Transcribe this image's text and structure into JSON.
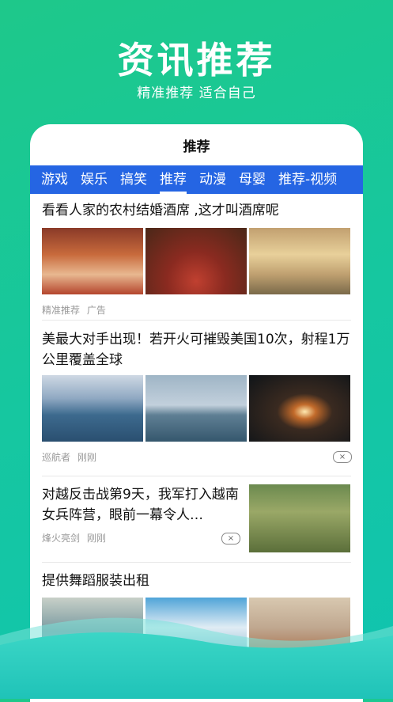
{
  "hero": {
    "title": "资讯推荐",
    "subtitle": "精准推荐 适合自己"
  },
  "app": {
    "title": "推荐"
  },
  "tabs": [
    "游戏",
    "娱乐",
    "搞笑",
    "推荐",
    "动漫",
    "母婴",
    "推荐-视频"
  ],
  "active_tab": "推荐",
  "news": [
    {
      "headline": "看看人家的农村结婚酒席 ,这才叫酒席呢",
      "source": "精准推荐",
      "time": "广告"
    },
    {
      "headline": "美最大对手出现！若开火可摧毁美国10次，射程1万公里覆盖全球",
      "source": "巡航者",
      "time": "刚刚",
      "close": "×"
    },
    {
      "headline": "对越反击战第9天，我军打入越南女兵阵营，眼前一幕令人…",
      "source": "烽火亮剑",
      "time": "刚刚",
      "close": "×"
    },
    {
      "headline": "提供舞蹈服装出租"
    }
  ],
  "colors": {
    "accent": "#2565e3",
    "bg_top": "#1ec88a",
    "bg_bottom": "#10c4b0"
  }
}
